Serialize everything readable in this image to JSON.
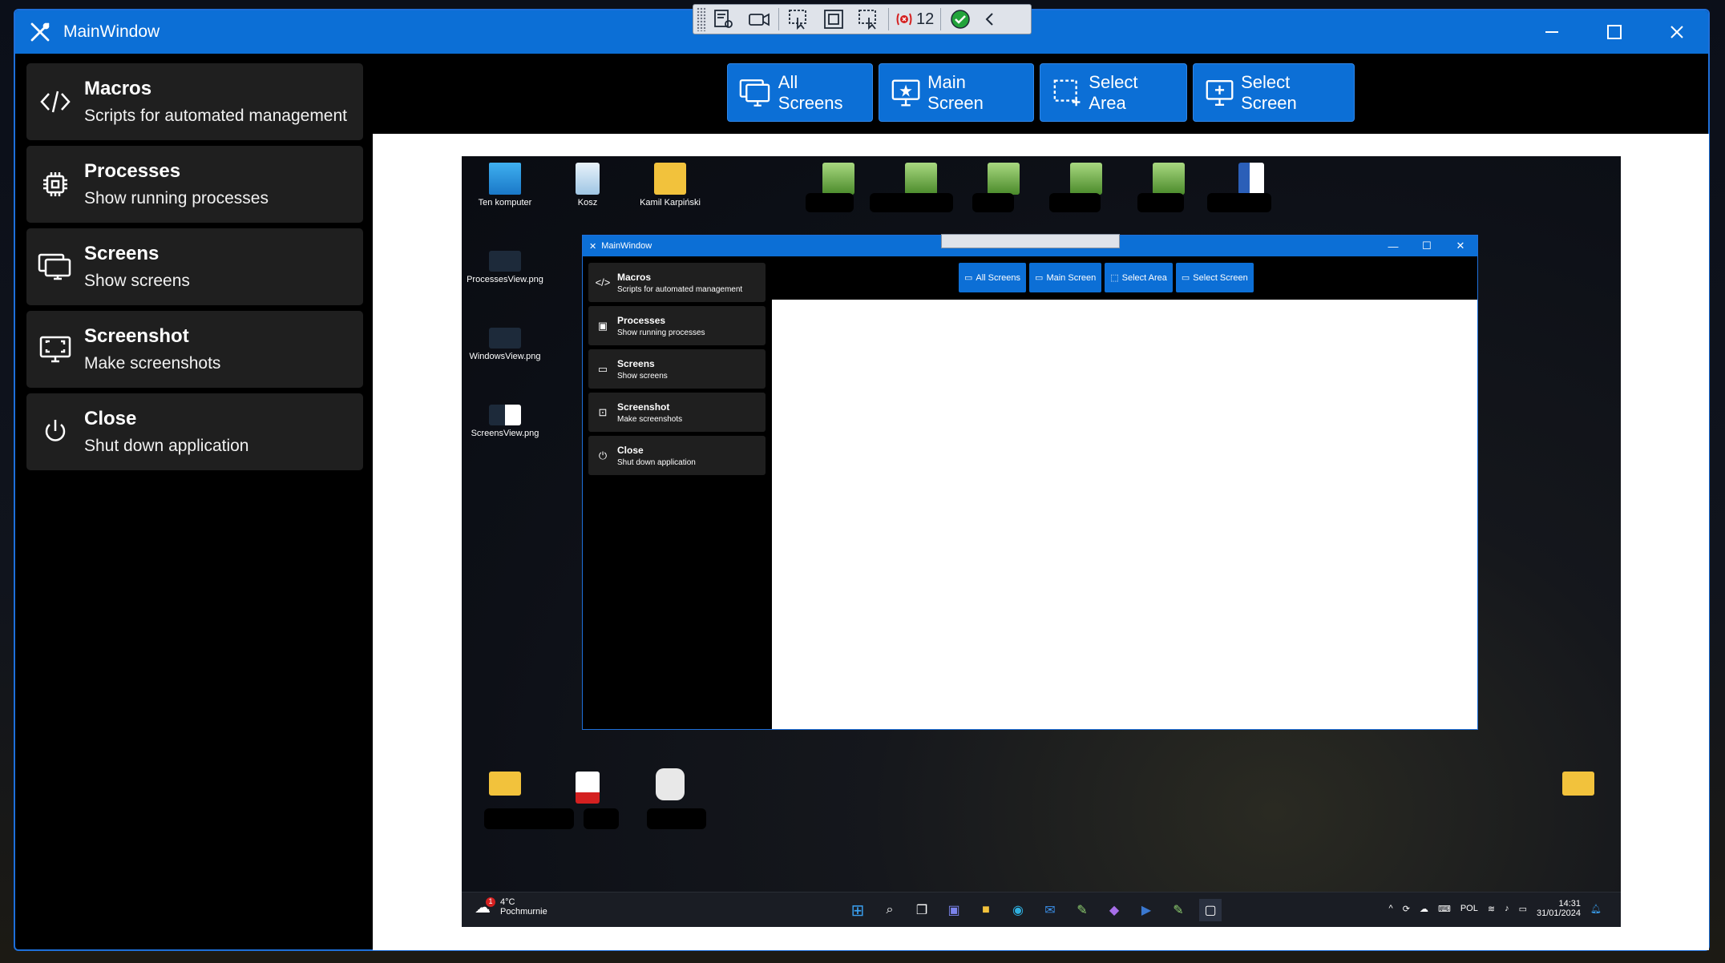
{
  "window": {
    "title": "MainWindow",
    "controls": {
      "minimize": "minimize",
      "maximize": "maximize",
      "close": "close"
    }
  },
  "toolbar": {
    "icons": [
      "grip-icon",
      "settings-list-icon",
      "video-camera-icon",
      "select-pointer-icon",
      "frame-icon",
      "select-screen-icon",
      "record-icon",
      "check-icon",
      "chevron-left-icon"
    ],
    "counter": "12"
  },
  "sidebar": {
    "items": [
      {
        "title": "Macros",
        "subtitle": "Scripts for automated management",
        "icon": "code-icon"
      },
      {
        "title": "Processes",
        "subtitle": "Show running processes",
        "icon": "cpu-icon"
      },
      {
        "title": "Screens",
        "subtitle": "Show screens",
        "icon": "monitors-icon"
      },
      {
        "title": "Screenshot",
        "subtitle": "Make screenshots",
        "icon": "screenshot-icon"
      },
      {
        "title": "Close",
        "subtitle": "Shut down application",
        "icon": "power-icon"
      }
    ]
  },
  "buttons": {
    "all_screens": "All Screens",
    "main_screen": "Main Screen",
    "select_area": "Select Area",
    "select_screen": "Select Screen"
  },
  "preview": {
    "desktop_icons": {
      "ten_komputer": "Ten komputer",
      "kosz": "Kosz",
      "user": "Kamil Karpiński",
      "processes_png": "ProcessesView.png",
      "windows_png": "WindowsView.png",
      "screens_png": "ScreensView.png"
    },
    "taskbar": {
      "temperature": "4°C",
      "weather": "Pochmurnie",
      "lang": "POL",
      "time": "14:31",
      "date": "31/01/2024",
      "weather_badge": "1"
    }
  },
  "colors": {
    "accent": "#0c6fd6",
    "sidebar_item": "#1f1f1f",
    "background": "#000000"
  }
}
